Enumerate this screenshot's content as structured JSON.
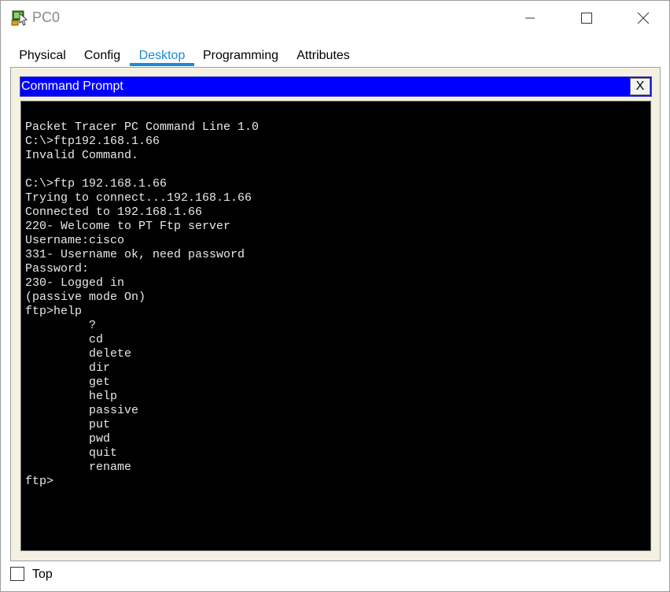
{
  "window": {
    "title": "PC0",
    "icon": "packet-tracer-pc-icon"
  },
  "tabs": [
    {
      "label": "Physical",
      "active": false
    },
    {
      "label": "Config",
      "active": false
    },
    {
      "label": "Desktop",
      "active": true
    },
    {
      "label": "Programming",
      "active": false
    },
    {
      "label": "Attributes",
      "active": false
    }
  ],
  "command_prompt": {
    "title": "Command Prompt",
    "close_label": "X",
    "lines": [
      "Packet Tracer PC Command Line 1.0",
      "C:\\>ftp192.168.1.66",
      "Invalid Command.",
      "",
      "C:\\>ftp 192.168.1.66",
      "Trying to connect...192.168.1.66",
      "Connected to 192.168.1.66",
      "220- Welcome to PT Ftp server",
      "Username:cisco",
      "331- Username ok, need password",
      "Password:",
      "230- Logged in",
      "(passive mode On)",
      "ftp>help",
      "         ?",
      "         cd",
      "         delete",
      "         dir",
      "         get",
      "         help",
      "         passive",
      "         put",
      "         pwd",
      "         quit",
      "         rename",
      "ftp>"
    ]
  },
  "footer": {
    "top_label": "Top",
    "top_checked": false
  },
  "colors": {
    "accent": "#1a8ad4",
    "header_blue": "#0000ff",
    "panel_bg": "#f4f1e2",
    "terminal_bg": "#000000",
    "terminal_fg": "#e8e8e8"
  }
}
